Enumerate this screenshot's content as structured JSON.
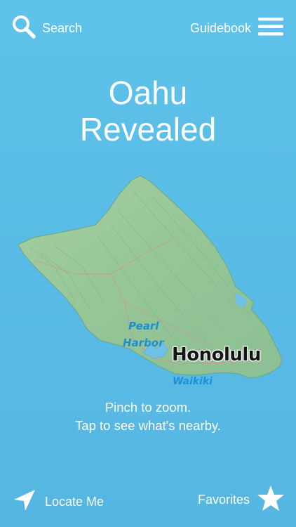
{
  "toolbar": {
    "search_label": "Search",
    "guidebook_label": "Guidebook"
  },
  "title": {
    "line1": "Oahu",
    "line2": "Revealed"
  },
  "map": {
    "labels": {
      "pearl": "Pearl",
      "harbor": "Harbor",
      "honolulu": "Honolulu",
      "waikiki": "Waikiki"
    }
  },
  "hint": {
    "line1": "Pinch to zoom.",
    "line2": "Tap to see what's nearby."
  },
  "bottom": {
    "locate_label": "Locate Me",
    "favorites_label": "Favorites"
  },
  "colors": {
    "background": "#5ec2ea",
    "land": "#9ac99b",
    "place_label": "#1f8fd4",
    "text": "#ffffff"
  }
}
